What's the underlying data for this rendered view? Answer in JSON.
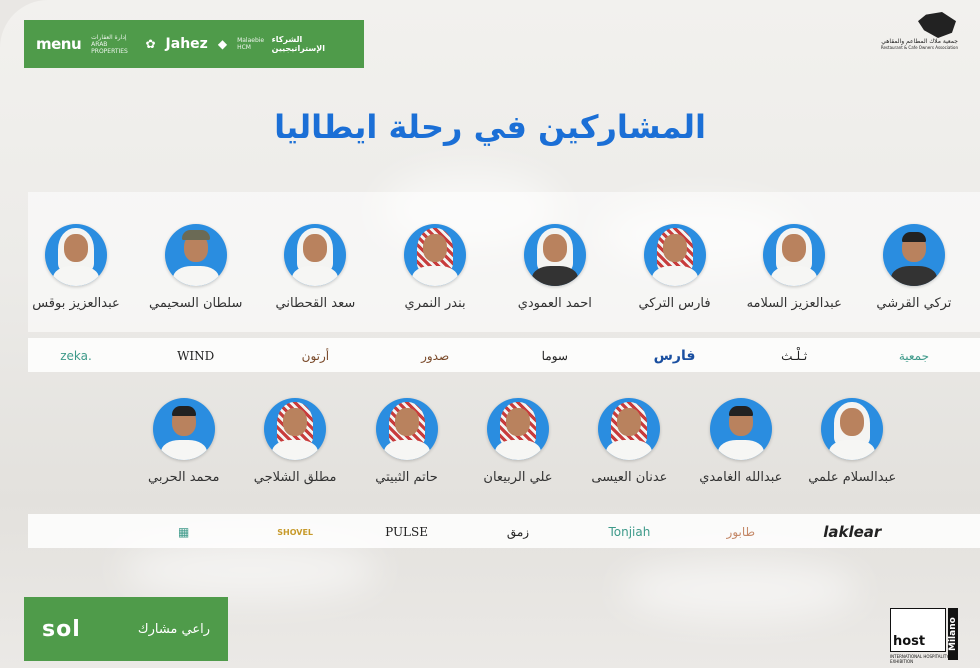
{
  "partners": {
    "title": "الشركاء الإستراتيجيين",
    "menu": "menu",
    "arabic_props": "إدارة العقارات",
    "arabic_props_en": "ARAB PROPERTIES",
    "jahez": "Jahez",
    "malaebi": "Malaebie HCM"
  },
  "association": {
    "name_ar": "جمعية ملاك المطاعم والمقاهي",
    "name_en": "Restaurant & Cafe Owners Association"
  },
  "headline": "المشاركين في رحلة ايطاليا",
  "row1": [
    {
      "name": "تركي القرشي",
      "logo": "جمعية",
      "style": "green"
    },
    {
      "name": "عبدالعزيز السلامه",
      "logo": "ثـلْـث",
      "style": "serif"
    },
    {
      "name": "فارس التركي",
      "logo": "فارس",
      "style": "blue"
    },
    {
      "name": "احمد العمودي",
      "logo": "سوما",
      "style": "serif"
    },
    {
      "name": "بندر النمري",
      "logo": "صدور",
      "style": "brown"
    },
    {
      "name": "سعد القحطاني",
      "logo": "أرتون",
      "style": "brown"
    },
    {
      "name": "سلطان السحيمي",
      "logo": "WIND",
      "style": "serif"
    },
    {
      "name": "عبدالعزيز بوقس",
      "logo": "zeka.",
      "style": "green"
    }
  ],
  "row2": [
    {
      "name": "عبدالسلام علمي",
      "logo": "laklear",
      "style": "bold"
    },
    {
      "name": "عبدالله الغامدي",
      "logo": "طابور",
      "style": "pink"
    },
    {
      "name": "عدنان العيسى",
      "logo": "Tonjiah",
      "style": "green"
    },
    {
      "name": "علي الربيعان",
      "logo": "زمق",
      "style": "serif"
    },
    {
      "name": "حاتم الثبيتي",
      "logo": "PULSE",
      "style": "serif"
    },
    {
      "name": "مطلق الشلاجي",
      "logo": "SHOVEL",
      "style": "gold"
    },
    {
      "name": "محمد الحربي",
      "logo": "▦",
      "style": "green"
    }
  ],
  "sponsor": {
    "brand": "sol",
    "label": "راعي مشارك"
  },
  "host": {
    "brand": "host",
    "city": "Milano",
    "subtitle": "INTERNATIONAL HOSPITALITY EXHIBITION"
  }
}
